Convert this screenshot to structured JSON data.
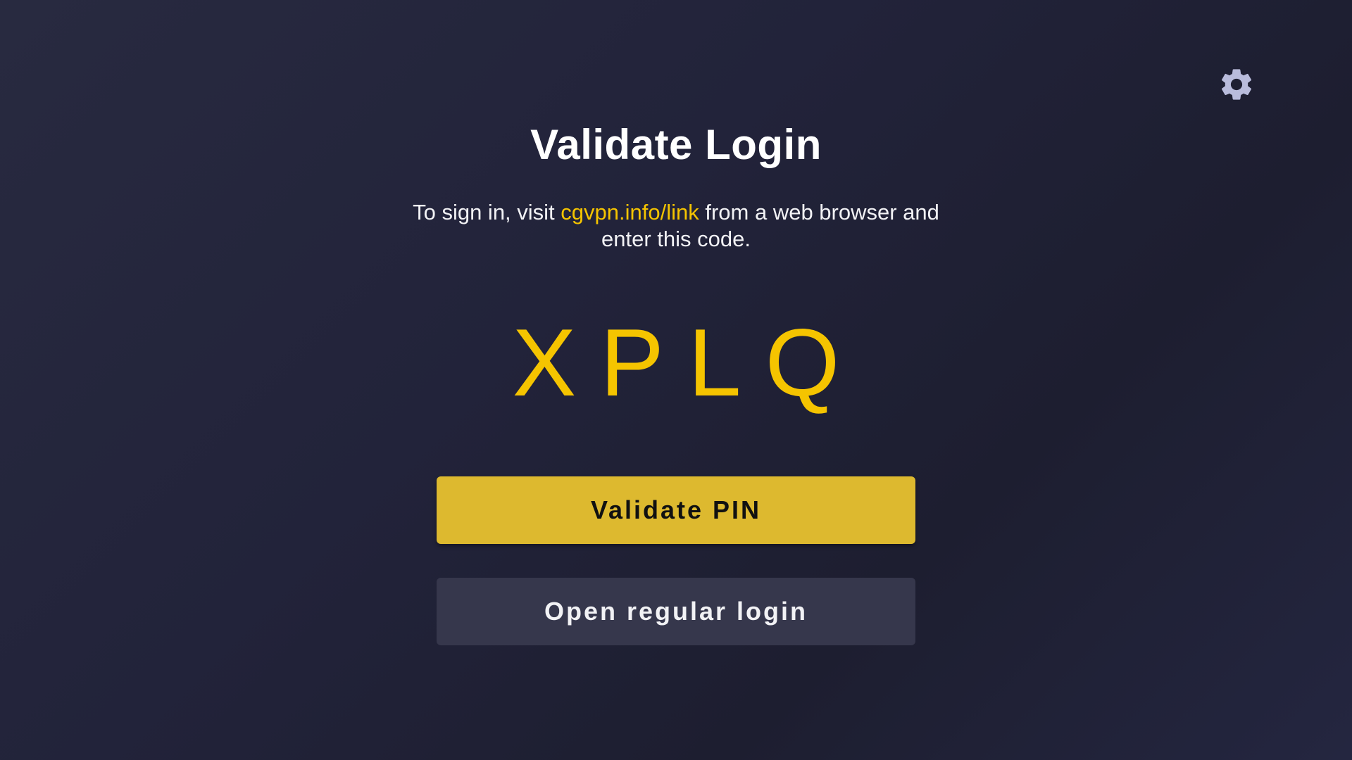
{
  "header": {
    "settings_icon": "gear-icon",
    "icon_color": "#b9bcdc"
  },
  "main": {
    "title": "Validate Login",
    "instructions": {
      "prefix": "To sign in, visit ",
      "link": "cgvpn.info/link",
      "suffix": " from a web browser and enter this code."
    },
    "code": "XPLQ",
    "validate_button_label": "Validate PIN",
    "regular_login_button_label": "Open regular login"
  },
  "colors": {
    "accent": "#f5c400",
    "primary_button": "#ddb92f",
    "secondary_button": "#36374c",
    "background": "#22233a"
  }
}
